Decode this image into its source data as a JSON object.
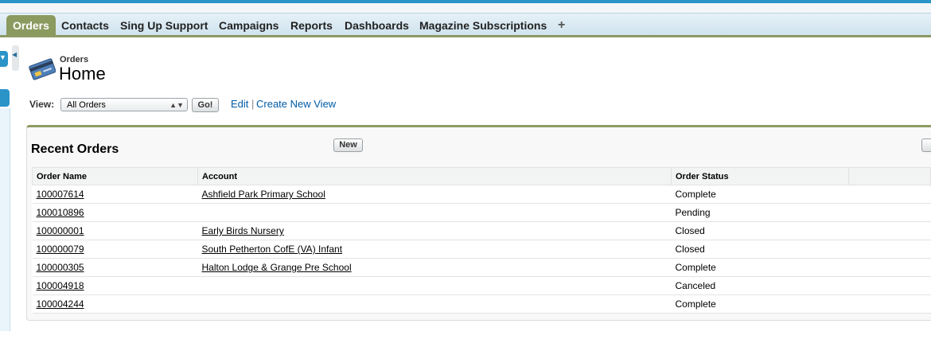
{
  "tabs": [
    {
      "label": "Orders",
      "active": true
    },
    {
      "label": "Contacts"
    },
    {
      "label": "Sing Up Support"
    },
    {
      "label": "Campaigns"
    },
    {
      "label": "Reports"
    },
    {
      "label": "Dashboards"
    },
    {
      "label": "Magazine Subscriptions"
    }
  ],
  "add_tab_label": "+",
  "page": {
    "kicker": "Orders",
    "title": "Home",
    "icon": "credit-card-icon"
  },
  "view": {
    "label": "View:",
    "selected": "All Orders",
    "go_label": "Go!",
    "edit_label": "Edit",
    "separator": "|",
    "create_label": "Create New View"
  },
  "recent": {
    "title": "Recent Orders",
    "new_label": "New",
    "columns": [
      "Order Name",
      "Account",
      "Order Status"
    ],
    "rows": [
      {
        "name": "100007614",
        "account": "Ashfield Park Primary School",
        "status": "Complete"
      },
      {
        "name": "100010896",
        "account": "",
        "status": "Pending"
      },
      {
        "name": "100000001",
        "account": "Early Birds Nursery",
        "status": "Closed"
      },
      {
        "name": "100000079",
        "account": "South Petherton CofE (VA) Infant",
        "status": "Closed"
      },
      {
        "name": "100000305",
        "account": "Halton Lodge & Grange Pre School",
        "status": "Complete"
      },
      {
        "name": "100004918",
        "account": "",
        "status": "Canceled"
      },
      {
        "name": "100004244",
        "account": "",
        "status": "Complete"
      }
    ]
  },
  "colors": {
    "accent_blue": "#2a94c9",
    "tab_active": "#8b9a5f",
    "link": "#015ba7"
  }
}
